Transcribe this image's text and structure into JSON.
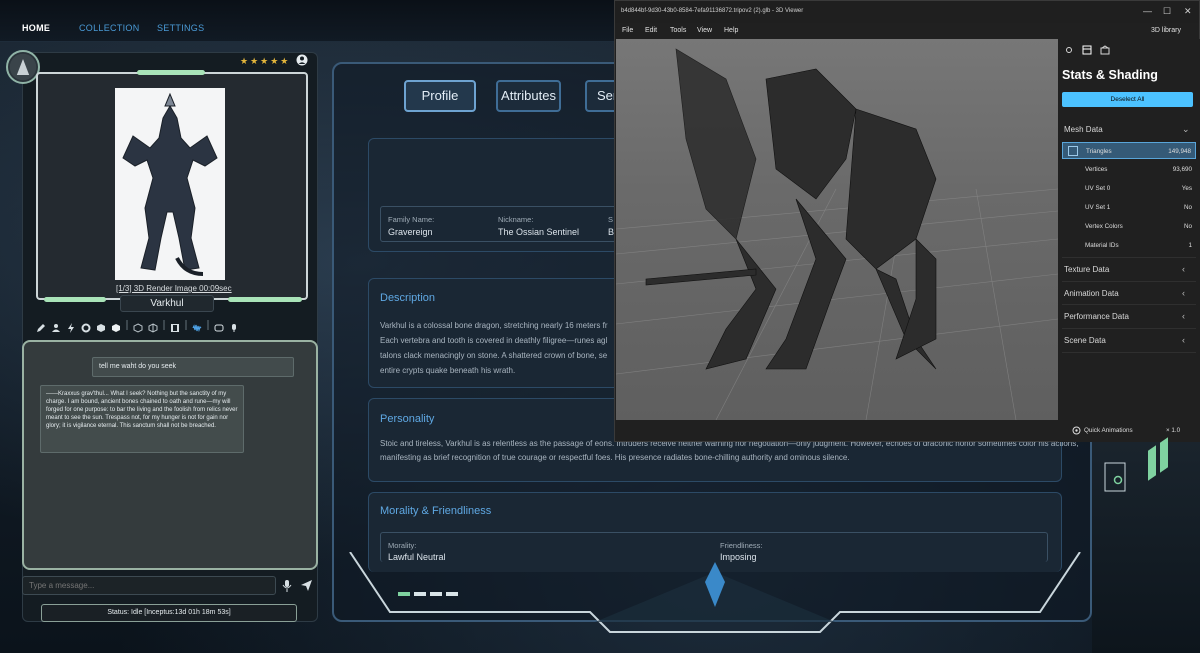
{
  "nav": {
    "items": [
      {
        "label": "HOME",
        "active": true
      },
      {
        "label": "COLLECTION",
        "active": false
      },
      {
        "label": "SETTINGS",
        "active": false
      }
    ]
  },
  "character": {
    "stars": "★★★★★",
    "rating": 5,
    "render_caption": "[1/3] 3D Render Image 00:09sec",
    "name": "Varkhul"
  },
  "chat": {
    "user_message": "tell me waht do you seek",
    "bot_message": "——Kraxxus grav'thul... What I seek? Nothing but the sanctity of my charge. I am bound, ancient bones chained to oath and rune—my will forged for one purpose: to bar the living and the foolish from relics never meant to see the sun. Trespass not, for my hunger is not for gain nor glory; it is vigilance eternal. This sanctum shall not be breached.",
    "input_placeholder": "Type a message...",
    "status": "Status: Idle [Inceptus:13d 01h 18m 53s]"
  },
  "profile": {
    "tabs": [
      {
        "label": "Profile",
        "active": true
      },
      {
        "label": "Attributes",
        "active": false
      },
      {
        "label": "Ser",
        "active": false
      }
    ],
    "family_name_label": "Family Name:",
    "family_name": "Gravereign",
    "nickname_label": "Nickname:",
    "nickname": "The Ossian Sentinel",
    "partial_label": "S",
    "partial_value": "B",
    "description_title": "Description",
    "description_lines": [
      "Varkhul is a colossal bone dragon, stretching nearly 16 meters fr",
      "Each vertebra and tooth is covered in deathly filigree—runes agl",
      "talons clack menacingly on stone. A shattered crown of bone, se",
      "entire crypts quake beneath his wrath."
    ],
    "personality_title": "Personality",
    "personality_lines": [
      "Stoic and tireless, Varkhul is as relentless as the passage of eons. Intruders receive neither warning nor negotiation—only judgment. However, echoes of draconic honor sometimes color his actions,",
      "manifesting as brief recognition of true courage or respectful foes. His presence radiates bone-chilling authority and ominous silence."
    ],
    "morality_title": "Morality & Friendliness",
    "morality_label": "Morality:",
    "morality_value": "Lawful Neutral",
    "friendliness_label": "Friendliness:",
    "friendliness_value": "Imposing"
  },
  "viewer": {
    "title": "b4d844bf-9d30-43b0-8584-7efa91136872.tripov2 (2).glb - 3D Viewer",
    "library": "3D library",
    "menu": [
      "File",
      "Edit",
      "Tools",
      "View",
      "Help"
    ],
    "panel_title": "Stats & Shading",
    "deselect_label": "Deselect All",
    "mesh_header": "Mesh Data",
    "mesh_rows": [
      {
        "key": "Triangles",
        "value": "149,948",
        "selected": true
      },
      {
        "key": "Vertices",
        "value": "93,690",
        "selected": false
      },
      {
        "key": "UV Set 0",
        "value": "Yes",
        "selected": false
      },
      {
        "key": "UV Set 1",
        "value": "No",
        "selected": false
      },
      {
        "key": "Vertex Colors",
        "value": "No",
        "selected": false
      },
      {
        "key": "Material IDs",
        "value": "1",
        "selected": false
      }
    ],
    "collapsed_sections": [
      "Texture Data",
      "Animation Data",
      "Performance Data",
      "Scene Data"
    ],
    "quick_animations": "Quick Animations",
    "zoom": "× 1.0"
  },
  "colors": {
    "accent_blue": "#4cc2ff",
    "section_title": "#5fa8e3",
    "green_bar": "#a9e3b8",
    "star": "#e2b53b"
  }
}
